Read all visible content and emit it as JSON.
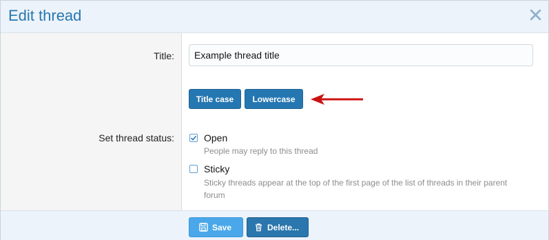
{
  "dialog": {
    "title": "Edit thread",
    "close_icon": "close-icon"
  },
  "form": {
    "title_label": "Title:",
    "title_value": "Example thread title",
    "title_case_button": "Title case",
    "lowercase_button": "Lowercase",
    "status_label": "Set thread status:",
    "options": [
      {
        "label": "Open",
        "checked": true,
        "hint": "People may reply to this thread"
      },
      {
        "label": "Sticky",
        "checked": false,
        "hint_line1": "Sticky threads appear at the top of the first page of the list of threads in their parent",
        "hint_line2": "forum"
      }
    ]
  },
  "footer": {
    "save_label": "Save",
    "delete_label": "Delete..."
  },
  "colors": {
    "accent": "#2577b1",
    "header_bg": "#edf3fa",
    "annotation_arrow": "#cc1111"
  }
}
